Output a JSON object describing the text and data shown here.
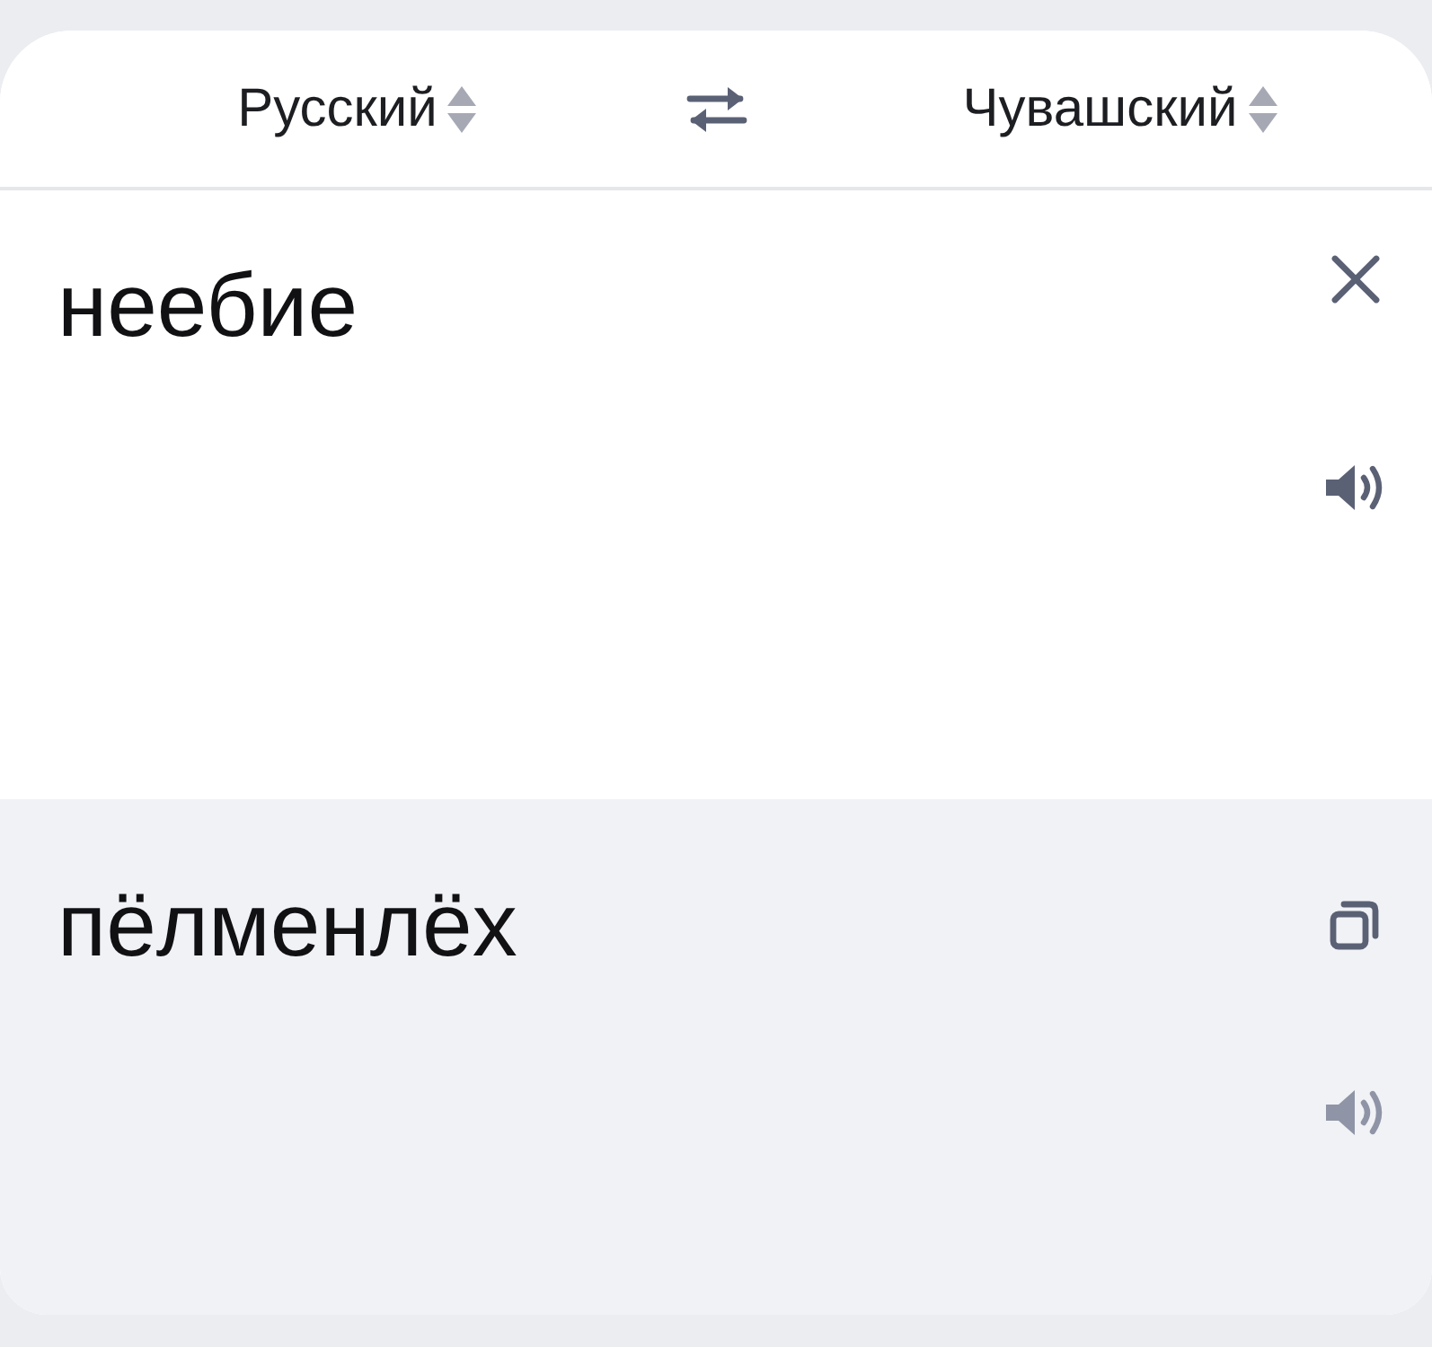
{
  "header": {
    "source_language": "Русский",
    "target_language": "Чувашский"
  },
  "input": {
    "text": "неебие",
    "speak_disabled": false
  },
  "output": {
    "text": "пёлменлёх",
    "speak_disabled": true
  }
}
